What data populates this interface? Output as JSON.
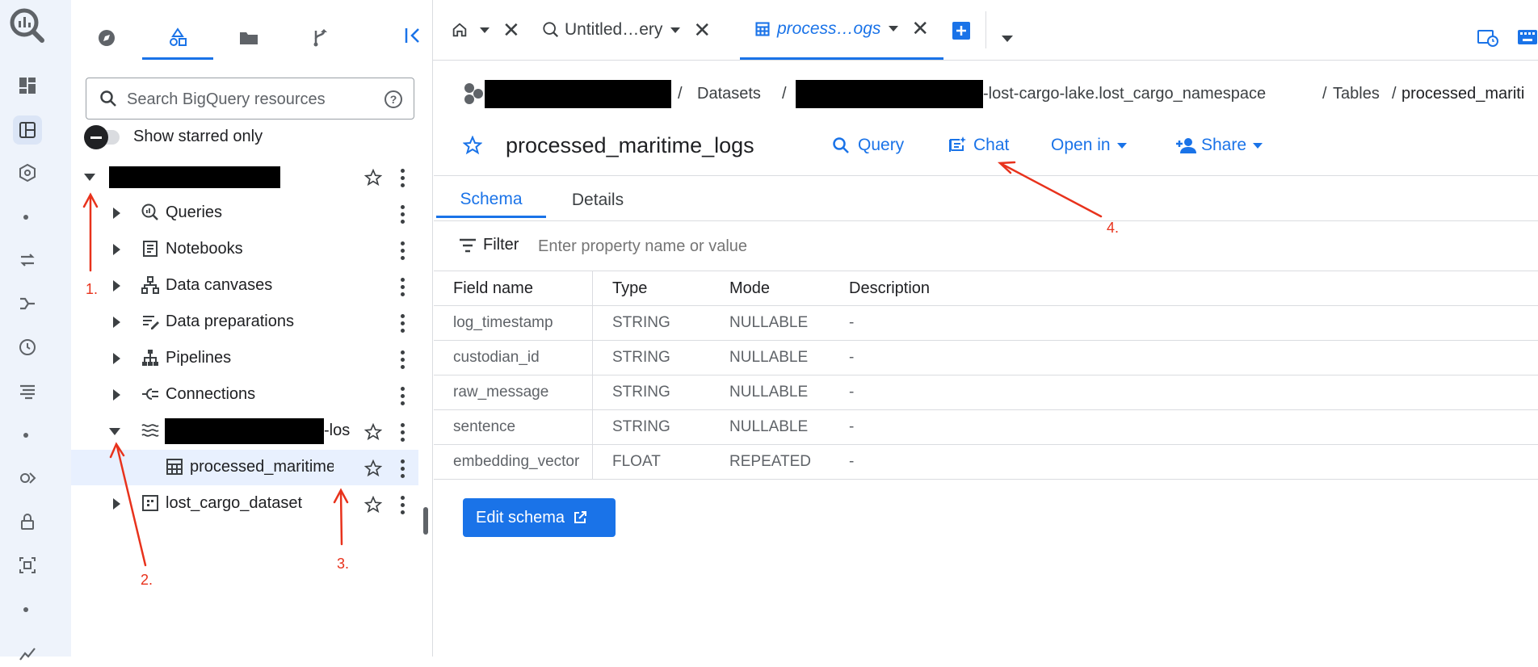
{
  "explorer": {
    "search_placeholder": "Search BigQuery resources",
    "starred_label": "Show starred only",
    "tree": [
      {
        "label": "Queries"
      },
      {
        "label": "Notebooks"
      },
      {
        "label": "Data canvases"
      },
      {
        "label": "Data preparations"
      },
      {
        "label": "Pipelines"
      },
      {
        "label": "Connections"
      }
    ],
    "dataset_suffix": "-lost",
    "table_item": "processed_maritime_lo",
    "dataset2": "lost_cargo_dataset"
  },
  "tabs": {
    "query_tab": "Untitled…ery",
    "table_tab": "process…ogs"
  },
  "breadcrumb": {
    "datasets": "Datasets",
    "dataset_name": "-lost-cargo-lake.lost_cargo_namespace",
    "tables": "Tables",
    "table": "processed_mariti"
  },
  "header": {
    "title": "processed_maritime_logs",
    "query": "Query",
    "chat": "Chat",
    "open_in": "Open in",
    "share": "Share"
  },
  "content_tabs": [
    "Schema",
    "Details"
  ],
  "filter": {
    "label": "Filter",
    "placeholder": "Enter property name or value"
  },
  "schema": {
    "columns": [
      "Field name",
      "Type",
      "Mode",
      "Description"
    ],
    "rows": [
      [
        "log_timestamp",
        "STRING",
        "NULLABLE",
        "-"
      ],
      [
        "custodian_id",
        "STRING",
        "NULLABLE",
        "-"
      ],
      [
        "raw_message",
        "STRING",
        "NULLABLE",
        "-"
      ],
      [
        "sentence",
        "STRING",
        "NULLABLE",
        "-"
      ],
      [
        "embedding_vector",
        "FLOAT",
        "REPEATED",
        "-"
      ]
    ]
  },
  "edit_schema": "Edit schema",
  "annotations": [
    "1.",
    "2.",
    "3.",
    "4."
  ],
  "colors": {
    "accent": "#1a73e8",
    "annotation": "#e8321c"
  }
}
